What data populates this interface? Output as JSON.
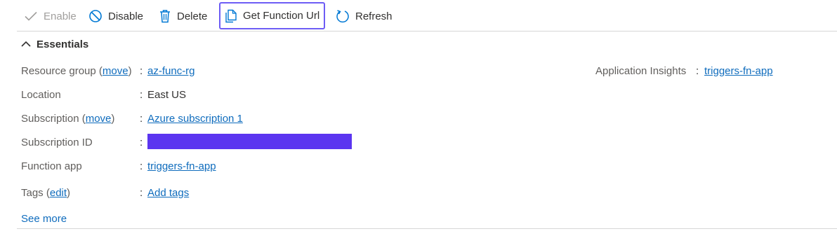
{
  "toolbar": {
    "enable_label": "Enable",
    "disable_label": "Disable",
    "delete_label": "Delete",
    "get_function_url_label": "Get Function Url",
    "refresh_label": "Refresh"
  },
  "essentials": {
    "title": "Essentials",
    "see_more": "See more",
    "left": {
      "resource_group": {
        "label": "Resource group",
        "link_text": "move",
        "value": "az-func-rg"
      },
      "location": {
        "label": "Location",
        "value": "East US"
      },
      "subscription": {
        "label": "Subscription",
        "link_text": "move",
        "value": "Azure subscription 1"
      },
      "subscription_id": {
        "label": "Subscription ID"
      },
      "function_app": {
        "label": "Function app",
        "value": "triggers-fn-app"
      },
      "tags": {
        "label": "Tags",
        "link_text": "edit",
        "value": "Add tags"
      }
    },
    "right": {
      "app_insights": {
        "label": "Application Insights",
        "value": "triggers-fn-app"
      }
    }
  },
  "punct": {
    "colon": ":",
    "open_paren": "(",
    "close_paren": ")"
  },
  "colors": {
    "link": "#0f6cbd",
    "accent": "#0078d4",
    "redaction": "#5b35f0",
    "focus": "#6d5cf5"
  }
}
